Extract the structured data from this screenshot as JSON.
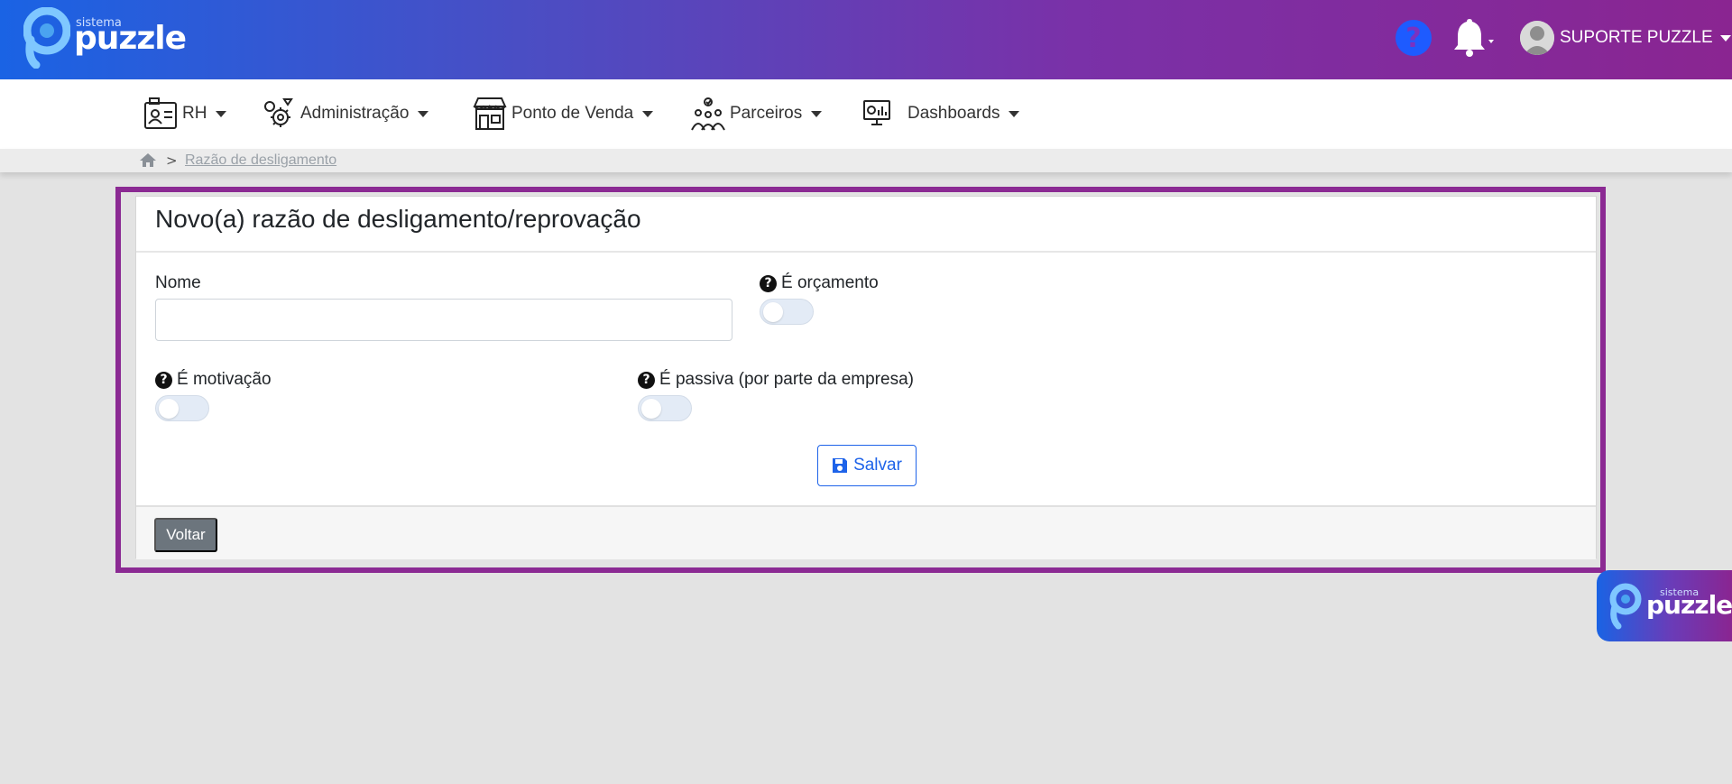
{
  "brand": {
    "small": "sistema",
    "big": "puzzle"
  },
  "header": {
    "help_label": "?",
    "user_name": "SUPORTE PUZZLE"
  },
  "nav": [
    {
      "label": "RH"
    },
    {
      "label": "Administração"
    },
    {
      "label": "Ponto de Venda"
    },
    {
      "label": "Parceiros"
    },
    {
      "label": "Dashboards"
    }
  ],
  "breadcrumb": {
    "separator": ">",
    "current": "Razão de desligamento"
  },
  "form": {
    "title": "Novo(a) razão de desligamento/reprovação",
    "name_label": "Nome",
    "name_value": "",
    "is_budget_label": "É orçamento",
    "is_budget": false,
    "is_motivation_label": "É motivação",
    "is_motivation": false,
    "is_passive_label": "É passiva (por parte da empresa)",
    "is_passive": false,
    "save_label": "Salvar",
    "back_label": "Voltar"
  },
  "colors": {
    "accent": "#8b2a93",
    "primary": "#1e63e9",
    "secondary": "#6c757d"
  }
}
